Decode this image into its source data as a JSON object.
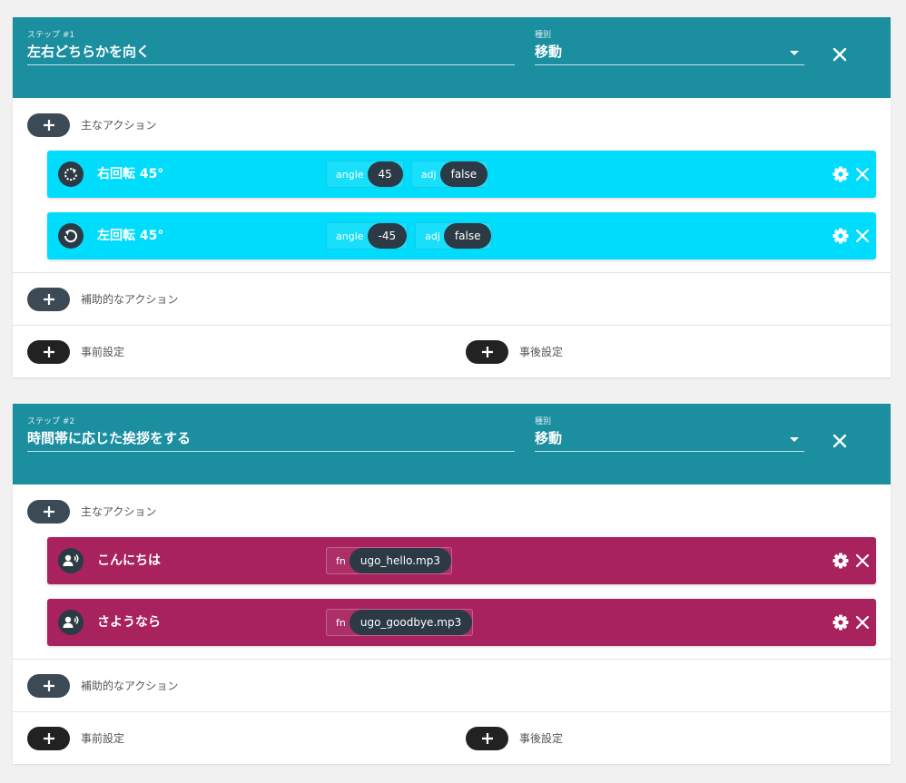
{
  "steps": [
    {
      "step_label": "ステップ #1",
      "step_title": "左右どちらかを向く",
      "type_label": "種別",
      "type_value": "移動",
      "main_actions_label": "主なアクション",
      "actions": [
        {
          "title": "右回転 45°",
          "icon": "rotate-right-icon",
          "color": "#00dcfb",
          "params": [
            {
              "name": "angle",
              "value": "45"
            },
            {
              "name": "adj",
              "value": "false"
            }
          ]
        },
        {
          "title": "左回転 45°",
          "icon": "rotate-left-icon",
          "color": "#00dcfb",
          "params": [
            {
              "name": "angle",
              "value": "-45"
            },
            {
              "name": "adj",
              "value": "false"
            }
          ]
        }
      ],
      "sub_actions_label": "補助的なアクション",
      "pre_settings_label": "事前設定",
      "post_settings_label": "事後設定"
    },
    {
      "step_label": "ステップ #2",
      "step_title": "時間帯に応じた挨拶をする",
      "type_label": "種別",
      "type_value": "移動",
      "main_actions_label": "主なアクション",
      "actions": [
        {
          "title": "こんにちは",
          "icon": "speaker-icon",
          "color": "#a8235e",
          "params": [
            {
              "name": "fn",
              "value": "ugo_hello.mp3"
            }
          ]
        },
        {
          "title": "さようなら",
          "icon": "speaker-icon",
          "color": "#a8235e",
          "params": [
            {
              "name": "fn",
              "value": "ugo_goodbye.mp3"
            }
          ]
        }
      ],
      "sub_actions_label": "補助的なアクション",
      "pre_settings_label": "事前設定",
      "post_settings_label": "事後設定"
    }
  ],
  "colors": {
    "header": "#1b8fa0",
    "cyan_card": "#00dcfb",
    "magenta_card": "#a8235e",
    "chip": "#2b3a44"
  }
}
